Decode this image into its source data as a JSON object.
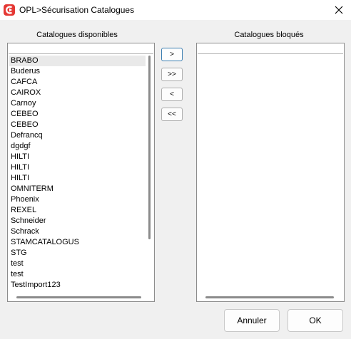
{
  "window": {
    "title": "OPL>Sécurisation Catalogues",
    "app_icon": "app-logo-icon",
    "close_icon": "close-icon"
  },
  "left_panel": {
    "label": "Catalogues disponibles",
    "items": [
      "BRABO",
      "Buderus",
      "CAFCA",
      "CAIROX",
      "Carnoy",
      "CEBEO",
      "CEBEO",
      "Defrancq",
      "dgdgf",
      "HILTI",
      "HILTI",
      "HILTI",
      "OMNITERM",
      "Phoenix",
      "REXEL",
      "Schneider",
      "Schrack",
      "STAMCATALOGUS",
      "STG",
      "test",
      "test",
      "TestImport123"
    ],
    "selected_item": "BRABO"
  },
  "right_panel": {
    "label": "Catalogues bloqués",
    "items": []
  },
  "move_buttons": {
    "add": ">",
    "add_all": ">>",
    "remove": "<",
    "remove_all": "<<"
  },
  "dialog_buttons": {
    "cancel": "Annuler",
    "ok": "OK"
  },
  "colors": {
    "app_icon": "#e53935",
    "focus_border": "#3c7fb1",
    "selection": "#e9e9e9"
  }
}
